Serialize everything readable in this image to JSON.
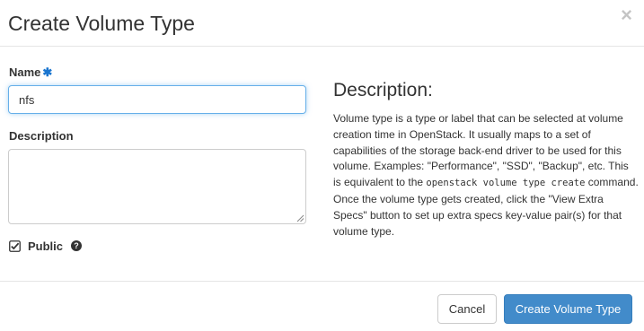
{
  "dialog": {
    "title": "Create Volume Type",
    "close_glyph": "×"
  },
  "form": {
    "name_label": "Name",
    "required_marker": "✱",
    "name_value": "nfs",
    "description_label": "Description",
    "description_value": "",
    "public_label": "Public",
    "public_checked": true,
    "help_glyph": "?"
  },
  "help": {
    "heading": "Description:",
    "text_before_code": "Volume type is a type or label that can be selected at volume creation time in OpenStack. It usually maps to a set of capabilities of the storage back-end driver to be used for this volume. Examples: \"Performance\", \"SSD\", \"Backup\", etc. This is equivalent to the ",
    "code": "openstack volume type create",
    "text_after_code": " command. Once the volume type gets created, click the \"View Extra Specs\" button to set up extra specs key-value pair(s) for that volume type."
  },
  "footer": {
    "cancel_label": "Cancel",
    "submit_label": "Create Volume Type"
  },
  "colors": {
    "primary": "#428bca",
    "required": "#1a75cf",
    "focus_border": "#66afe9"
  }
}
